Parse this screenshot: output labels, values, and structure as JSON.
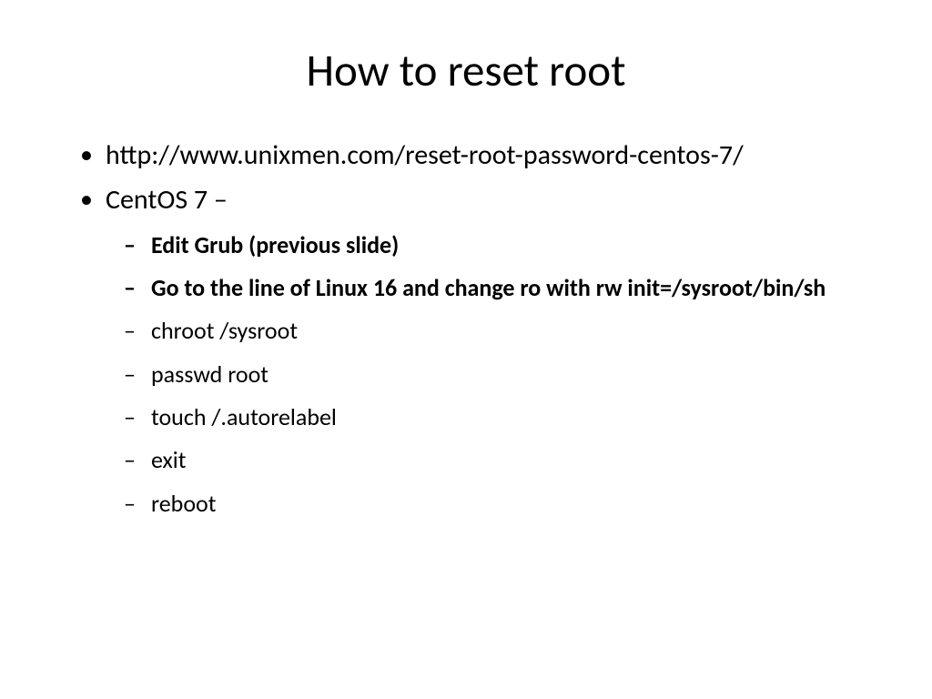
{
  "title": "How to reset root",
  "bullets": {
    "url": "http://www.unixmen.com/reset-root-password-centos-7/",
    "os_label": "CentOS 7 –",
    "steps": {
      "s1": "Edit Grub  (previous slide)",
      "s2": "Go to the line of Linux 16 and change ro with rw init=/sysroot/bin/sh",
      "s3": "chroot /sysroot",
      "s4": "passwd root",
      "s5": "touch /.autorelabel",
      "s6": "exit",
      "s7": "reboot"
    }
  }
}
